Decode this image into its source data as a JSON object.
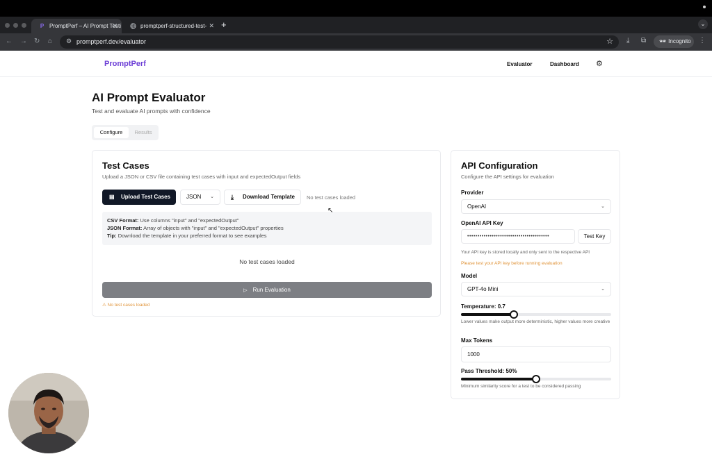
{
  "browser": {
    "tabs": [
      {
        "title": "PromptPerf – AI Prompt Testi",
        "active": true,
        "favicon": "P"
      },
      {
        "title": "promptperf-structured-test-",
        "active": false,
        "favicon": "globe-icon"
      }
    ],
    "new_tab": "+",
    "url": "promptperf.dev/evaluator",
    "incognito_label": "Incognito"
  },
  "app": {
    "brand": "PromptPerf",
    "nav": [
      {
        "label": "Evaluator"
      },
      {
        "label": "Dashboard"
      }
    ],
    "brand_color": "#6d3fd6"
  },
  "main": {
    "title": "AI Prompt Evaluator",
    "subtitle": "Test and evaluate AI prompts with confidence",
    "tabs": [
      {
        "label": "Configure",
        "active": true
      },
      {
        "label": "Results",
        "active": false
      }
    ]
  },
  "test_cases": {
    "title": "Test Cases",
    "subtitle": "Upload a JSON or CSV file containing test cases with input and expectedOutput fields",
    "upload_label": "Upload Test Cases",
    "format_value": "JSON",
    "download_label": "Download Template",
    "status": "No test cases loaded",
    "info": {
      "csv_label": "CSV Format:",
      "csv_text": " Use columns \"input\" and \"expectedOutput\"",
      "json_label": "JSON Format:",
      "json_text": " Array of objects with \"input\" and \"expectedOutput\" properties",
      "tip_label": "Tip:",
      "tip_text": " Download the template in your preferred format to see examples"
    },
    "empty_message": "No test cases loaded",
    "run_label": "Run Evaluation",
    "warning": "⚠ No test cases loaded",
    "warning_color": "#e0943a"
  },
  "api_config": {
    "title": "API Configuration",
    "subtitle": "Configure the API settings for evaluation",
    "provider_label": "Provider",
    "provider_value": "OpenAI",
    "key_label": "OpenAI API Key",
    "key_value": "••••••••••••••••••••••••••••••••••••••••",
    "test_key_label": "Test Key",
    "key_note": "Your API key is stored locally and only sent to the respective API",
    "key_warning": "Please test your API key before running evaluation",
    "model_label": "Model",
    "model_value": "GPT-4o Mini",
    "temperature_label": "Temperature: 0.7",
    "temperature_value": 0.7,
    "temperature_max": 2,
    "temperature_note": "Lower values make output more deterministic, higher values more creative",
    "max_tokens_label": "Max Tokens",
    "max_tokens_value": "1000",
    "threshold_label": "Pass Threshold: 50%",
    "threshold_value": 50,
    "threshold_note": "Minimum similarity score for a test to be considered passing"
  }
}
